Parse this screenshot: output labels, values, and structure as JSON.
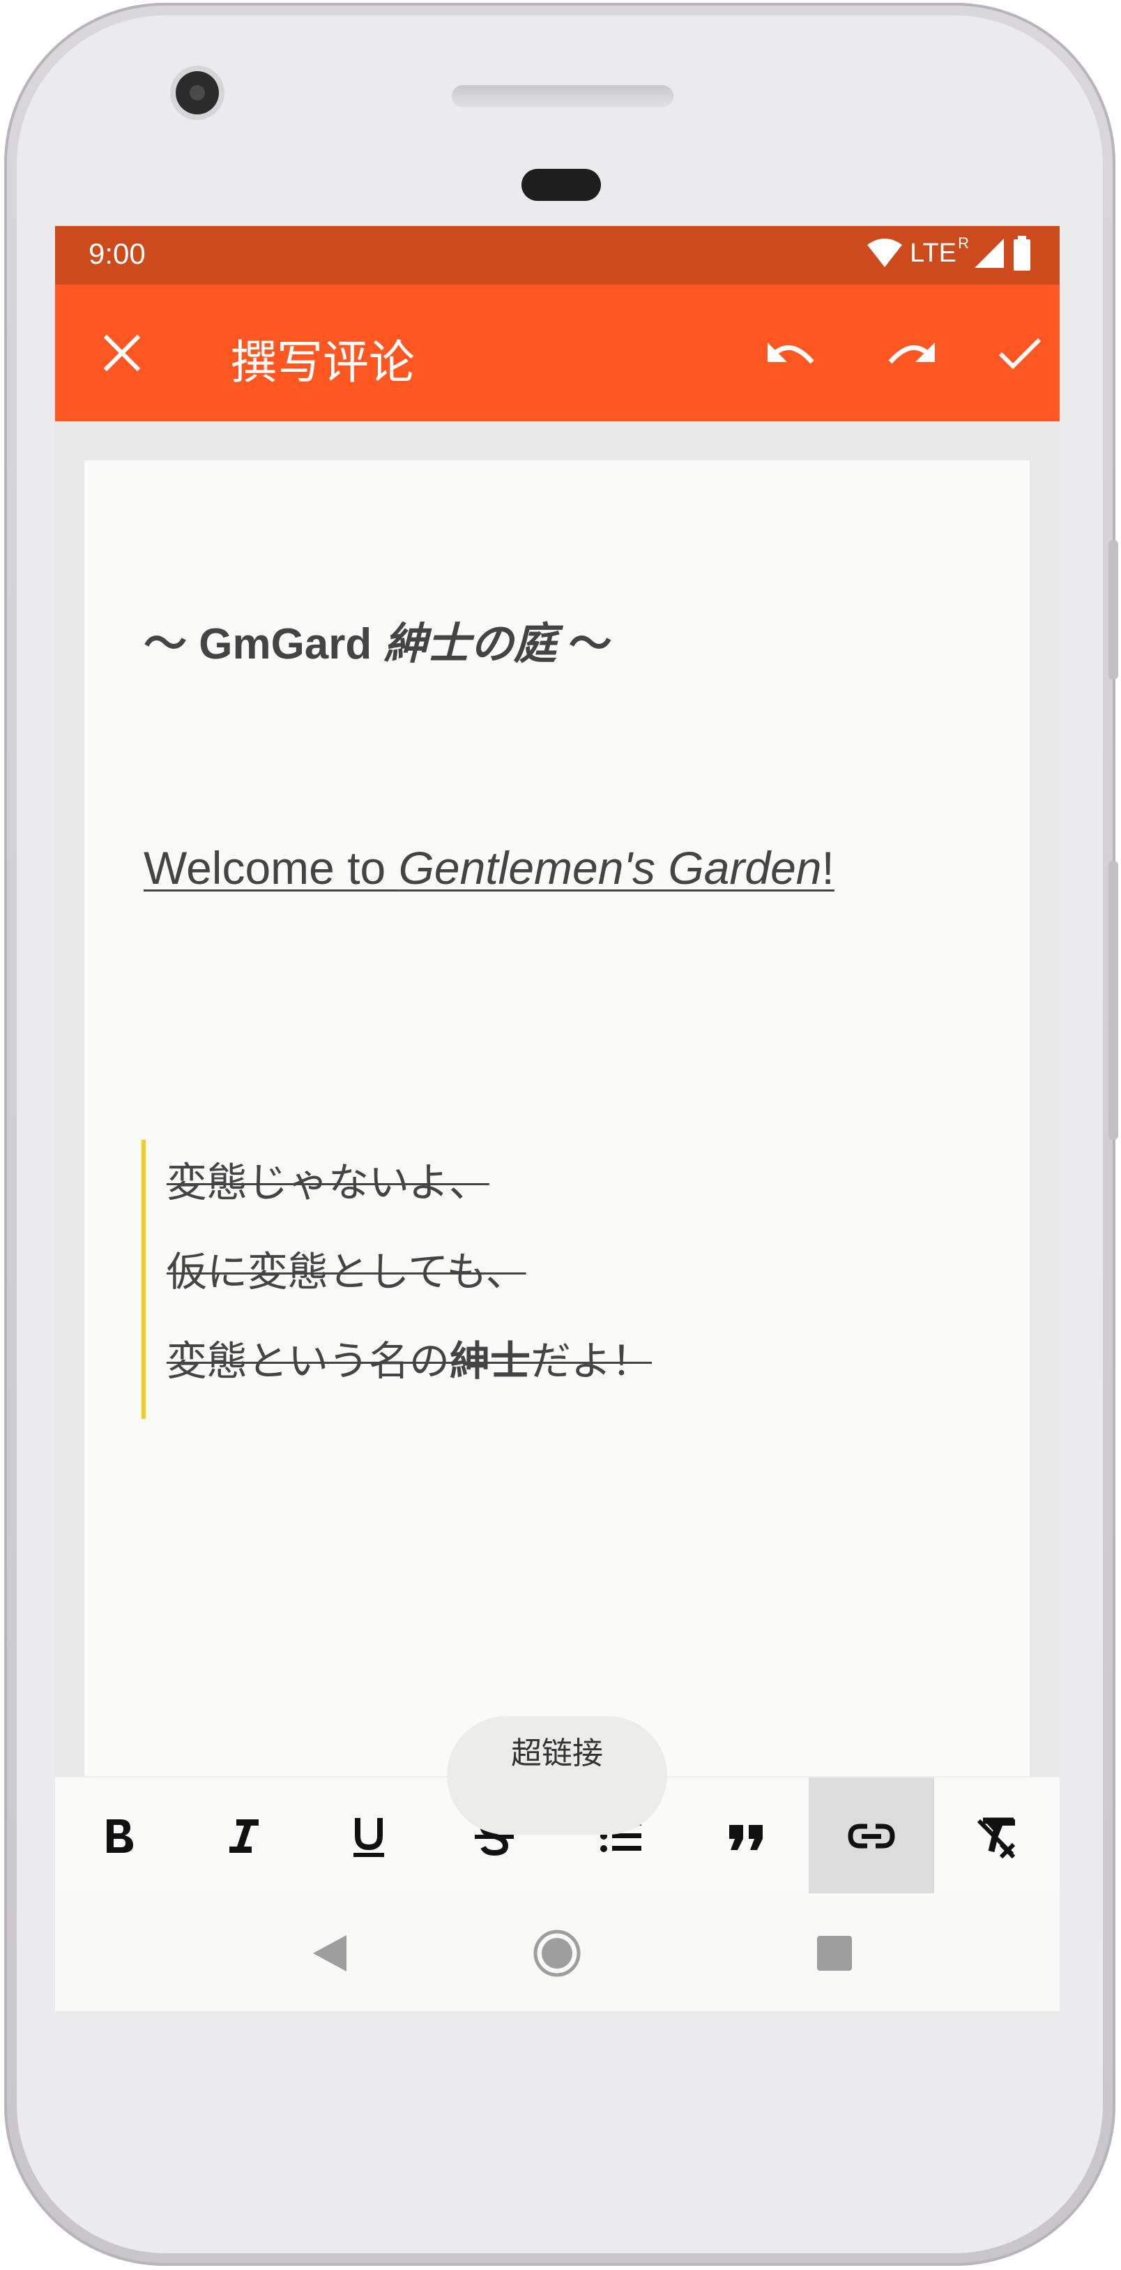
{
  "statusbar": {
    "time": "9:00",
    "network": "LTE",
    "roaming": "R",
    "icons": [
      "wifi-icon",
      "signal-icon",
      "battery-icon"
    ]
  },
  "toolbar": {
    "title": "撰写评论",
    "close_icon": "close-icon",
    "undo_icon": "undo-icon",
    "redo_icon": "redo-icon",
    "done_icon": "check-icon"
  },
  "editor": {
    "heading": {
      "prefix": "～ GmGard ",
      "italic": "紳士の庭",
      "suffix": " ～"
    },
    "welcome": {
      "prefix": "Welcome to ",
      "italic": "Gentlemen's Garden",
      "suffix": "!"
    },
    "quote": {
      "line1": "変態じゃないよ、",
      "line2": "仮に変態としても、",
      "line3_prefix": "変態という名の",
      "line3_bold": "紳士",
      "line3_suffix": "だよ！"
    }
  },
  "format_bar": {
    "buttons": [
      "bold",
      "italic",
      "underline",
      "strikethrough",
      "bullet-list",
      "quote",
      "link",
      "clear-format"
    ],
    "active": "link"
  },
  "tooltip": {
    "text": "超链接"
  },
  "colors": {
    "statusbar": "#cc4a1b",
    "toolbar": "#ff5722",
    "quote_border": "#f2cf1a",
    "text": "#444444"
  }
}
